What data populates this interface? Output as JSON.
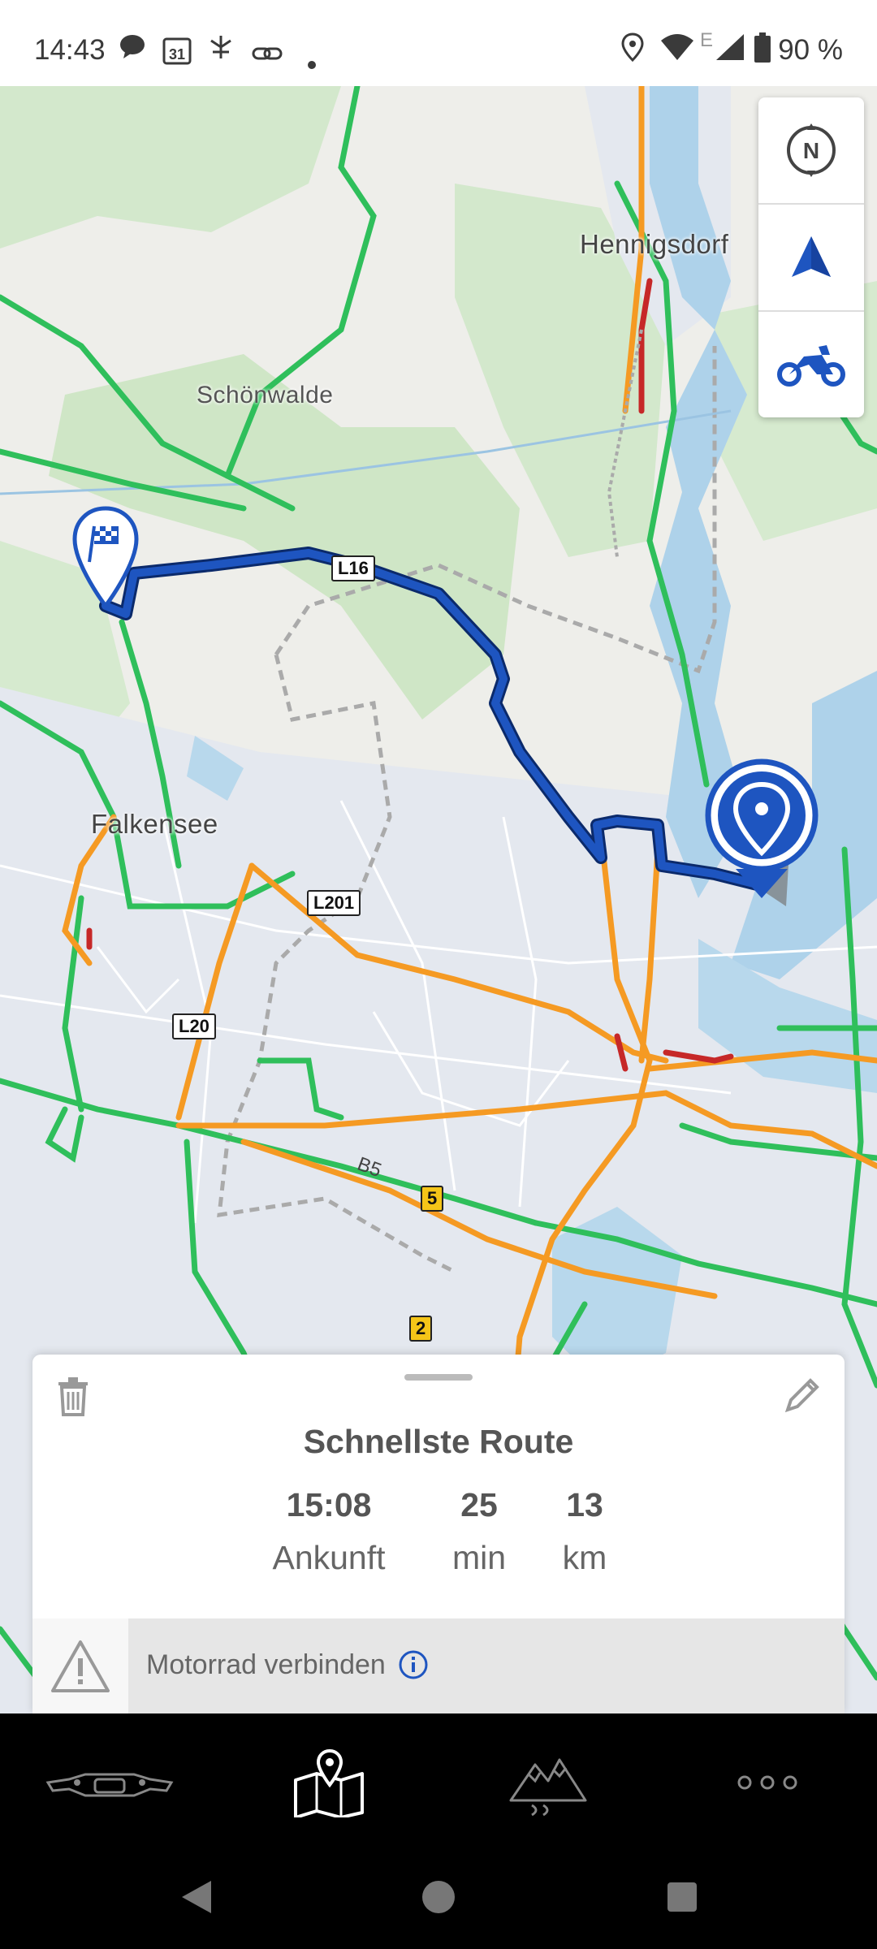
{
  "status_bar": {
    "time": "14:43",
    "battery_text": "90 %",
    "icons": [
      "chat-icon",
      "calendar-icon",
      "app-icon",
      "link-icon",
      "dot-icon",
      "location-icon",
      "wifi-icon",
      "signal-icon",
      "battery-icon"
    ],
    "calendar_day": "31",
    "network_type": "E"
  },
  "map": {
    "places": {
      "hennigsdorf": "Hennigsdorf",
      "schoenwalde": "Schönwalde",
      "falkensee": "Falkensee"
    },
    "road_shields": {
      "l16": "L16",
      "l201": "L201",
      "l20": "L20",
      "b5_label": "B5",
      "r5": "5",
      "r2": "2"
    },
    "controls": [
      "compass-north-icon",
      "navigation-arrow-icon",
      "motorcycle-icon"
    ],
    "compass_letter": "N",
    "route_color": "#1e55c0",
    "traffic_green": "#2fbf5b",
    "traffic_orange": "#f59a23"
  },
  "route_card": {
    "title": "Schnellste Route",
    "arrival_value": "15:08",
    "arrival_label": "Ankunft",
    "duration_value": "25",
    "duration_label": "min",
    "distance_value": "13",
    "distance_label": "km",
    "connect_text": "Motorrad verbinden"
  },
  "bottom_nav": {
    "items": [
      "motorcycle-cockpit-icon",
      "map-icon",
      "mountains-icon",
      "more-icon"
    ],
    "active": "map-icon"
  }
}
